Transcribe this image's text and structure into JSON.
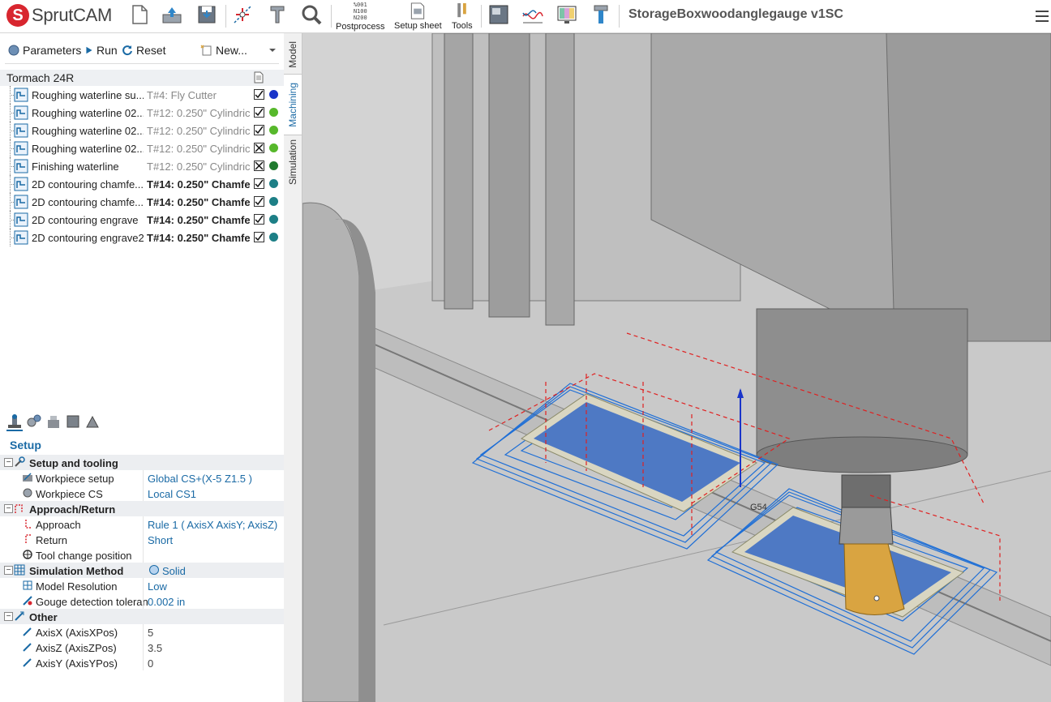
{
  "app": {
    "logo_text": "SprutCAM"
  },
  "toolbar": {
    "postprocess_label": "Postprocess",
    "postprocess_icon_text": "%001 N100 N200",
    "setup_sheet_label": "Setup sheet",
    "tools_label": "Tools",
    "project_title": "StorageBoxwoodanglegauge v1SC"
  },
  "side_tabs": {
    "model": "Model",
    "machining": "Machining",
    "simulation": "Simulation"
  },
  "ops_toolbar": {
    "parameters": "Parameters",
    "run": "Run",
    "reset": "Reset",
    "new": "New..."
  },
  "machine": {
    "name": "Tormach 24R"
  },
  "operations": [
    {
      "name": "Roughing waterline su...",
      "tool_num": "T#4:",
      "tool_desc": "Fly Cutter",
      "tool_bold": false,
      "check": "check",
      "status_color": "#1a35c9"
    },
    {
      "name": "Roughing waterline 02...",
      "tool_num": "T#12:",
      "tool_desc": "0.250\" Cylindric",
      "tool_bold": false,
      "check": "check",
      "status_color": "#57b82b"
    },
    {
      "name": "Roughing waterline 02...",
      "tool_num": "T#12:",
      "tool_desc": "0.250\" Cylindric",
      "tool_bold": false,
      "check": "check",
      "status_color": "#57b82b"
    },
    {
      "name": "Roughing waterline 02...",
      "tool_num": "T#12:",
      "tool_desc": "0.250\" Cylindric",
      "tool_bold": false,
      "check": "cross",
      "status_color": "#57b82b"
    },
    {
      "name": "Finishing waterline",
      "tool_num": "T#12:",
      "tool_desc": "0.250\" Cylindric",
      "tool_bold": false,
      "check": "cross",
      "status_color": "#1f7a2e"
    },
    {
      "name": "2D contouring chamfe...",
      "tool_num": "T#14:",
      "tool_desc": "0.250\" Chamfe",
      "tool_bold": true,
      "check": "check",
      "status_color": "#1d7f86"
    },
    {
      "name": "2D contouring chamfe...",
      "tool_num": "T#14:",
      "tool_desc": "0.250\" Chamfe",
      "tool_bold": true,
      "check": "check",
      "status_color": "#1d7f86"
    },
    {
      "name": "2D contouring engrave",
      "tool_num": "T#14:",
      "tool_desc": "0.250\" Chamfe",
      "tool_bold": true,
      "check": "check",
      "status_color": "#1d7f86"
    },
    {
      "name": "2D contouring engrave2",
      "tool_num": "T#14:",
      "tool_desc": "0.250\" Chamfe",
      "tool_bold": true,
      "check": "check",
      "status_color": "#1d7f86"
    }
  ],
  "setup": {
    "title": "Setup",
    "groups": {
      "setup_tooling": "Setup and tooling",
      "approach_return": "Approach/Return",
      "simulation_method": "Simulation Method",
      "other": "Other"
    },
    "props": {
      "workpiece_setup": {
        "label": "Workpiece setup",
        "value": "Global CS+(X-5 Z1.5 )"
      },
      "workpiece_cs": {
        "label": "Workpiece CS",
        "value": "Local CS1"
      },
      "approach": {
        "label": "Approach",
        "value": "Rule 1 ( AxisX AxisY; AxisZ)"
      },
      "return": {
        "label": "Return",
        "value": "Short"
      },
      "tool_change": {
        "label": "Tool change position"
      },
      "simulation_value": "Solid",
      "model_resolution": {
        "label": "Model Resolution",
        "value": "Low"
      },
      "gouge": {
        "label": "Gouge detection toleran",
        "value": "0.002 in"
      },
      "axis_x": {
        "label": "AxisX (AxisXPos)",
        "value": "5"
      },
      "axis_z": {
        "label": "AxisZ (AxisZPos)",
        "value": "3.5"
      },
      "axis_y": {
        "label": "AxisY (AxisYPos)",
        "value": "0"
      }
    }
  },
  "viewport": {
    "cs_label": "G54"
  },
  "colors": {
    "accent": "#1a6aa5",
    "logo_red": "#d8262f",
    "toolpath_blue": "#1f6fd6",
    "rapid_red": "#e02020",
    "tool_holder": "#d9a441"
  }
}
